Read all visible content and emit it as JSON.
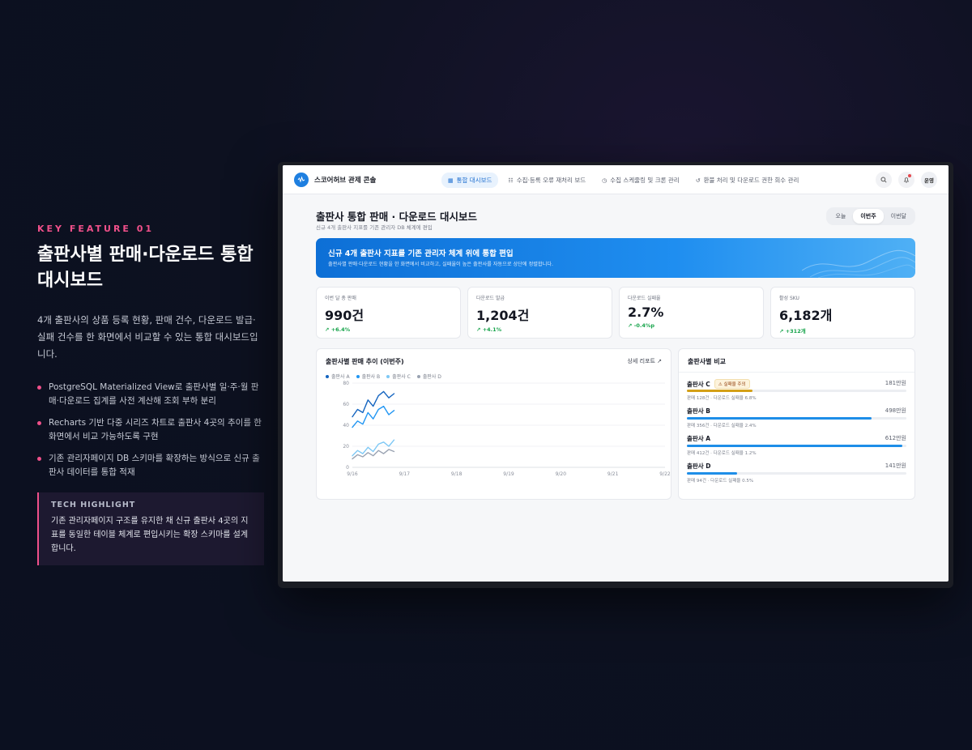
{
  "left": {
    "kicker": "KEY FEATURE 01",
    "headline": "출판사별 판매·다운로드 통합 대시보드",
    "lead": "4개 출판사의 상품 등록 현황, 판매 건수, 다운로드 발급·실패 건수를 한 화면에서 비교할 수 있는 통합 대시보드입니다.",
    "bullets": [
      "PostgreSQL Materialized View로 출판사별 일·주·월 판매·다운로드 집계를 사전 계산해 조회 부하 분리",
      "Recharts 기반 다중 시리즈 차트로 출판사 4곳의 추이를 한 화면에서 비교 가능하도록 구현",
      "기존 관리자페이지 DB 스키마를 확장하는 방식으로 신규 출판사 데이터를 통합 적재"
    ],
    "tech_title": "TECH HIGHLIGHT",
    "tech_body": "기존 관리자페이지 구조를 유지한 채 신규 출판사 4곳의 지표를 동일한 테이블 체계로 편입시키는 확장 스키마를 설계합니다."
  },
  "app": {
    "brand": "스코어허브 관제 콘솔",
    "nav": [
      {
        "label": "통합 대시보드",
        "icon": "grid-icon",
        "glyph": "▦"
      },
      {
        "label": "수집·등록 오류 재처리 보드",
        "icon": "list-icon",
        "glyph": "☷"
      },
      {
        "label": "수집 스케줄링 및 크론 관리",
        "icon": "clock-icon",
        "glyph": "◷"
      },
      {
        "label": "환불 처리 및 다운로드 권한 회수 관리",
        "icon": "undo-icon",
        "glyph": "↺"
      }
    ],
    "avatar": "운영",
    "page_title": "출판사 통합 판매 · 다운로드 대시보드",
    "page_sub": "신규 4개 출판사 지표를 기존 관리자 DB 체계에 편입",
    "periods": [
      "오늘",
      "이번주",
      "이번달"
    ],
    "banner_title": "신규 4개 출판사 지표를 기존 관리자 체계 위에 통합 편입",
    "banner_sub": "출판사별 판매·다운로드 현황을 한 화면에서 비교하고, 실패율이 높은 출판사를 자동으로 상단에 정렬합니다.",
    "kpis": [
      {
        "label": "이번 달 총 판매",
        "value": "990건",
        "delta": "↗ +6.4%"
      },
      {
        "label": "다운로드 발급",
        "value": "1,204건",
        "delta": "↗ +4.1%"
      },
      {
        "label": "다운로드 실패율",
        "value": "2.7%",
        "delta": "↗ -0.4%p"
      },
      {
        "label": "활성 SKU",
        "value": "6,182개",
        "delta": "↗ +312개"
      }
    ],
    "chart_title": "출판사별 판매 추이 (이번주)",
    "chart_link": "상세 리포트 ↗",
    "compare_title": "출판사별 비교",
    "compare": [
      {
        "name": "출판사 C",
        "badge": "⚠ 실패율 주의",
        "amount": "181만원",
        "meta": "판매 128건 · 다운로드 실패율 6.8%",
        "ratio": 0.3,
        "color": "#d4a017"
      },
      {
        "name": "출판사 B",
        "badge": "",
        "amount": "498만원",
        "meta": "판매 356건 · 다운로드 실패율 2.4%",
        "ratio": 0.84,
        "color": "#1e8ee8"
      },
      {
        "name": "출판사 A",
        "badge": "",
        "amount": "612만원",
        "meta": "판매 412건 · 다운로드 실패율 1.2%",
        "ratio": 0.98,
        "color": "#1e8ee8"
      },
      {
        "name": "출판사 D",
        "badge": "",
        "amount": "141만원",
        "meta": "판매 94건 · 다운로드 실패율 0.5%",
        "ratio": 0.23,
        "color": "#1e8ee8"
      }
    ]
  },
  "colors": {
    "accent": "#1e7fe0",
    "pink": "#f0508a",
    "warn": "#d4a017"
  },
  "chart_data": {
    "type": "line",
    "x": [
      "9/16",
      "9/17",
      "9/18",
      "9/19",
      "9/20",
      "9/21",
      "9/22"
    ],
    "ylim": [
      0,
      80
    ],
    "yticks": [
      0,
      20,
      40,
      60,
      80
    ],
    "grid": true,
    "legend": "top-left",
    "series": [
      {
        "name": "출판사 A",
        "color": "#1565c0",
        "points": [
          [
            0.0,
            48
          ],
          [
            0.1,
            55
          ],
          [
            0.2,
            52
          ],
          [
            0.3,
            64
          ],
          [
            0.4,
            58
          ],
          [
            0.5,
            68
          ],
          [
            0.6,
            72
          ],
          [
            0.7,
            66
          ],
          [
            0.8,
            70
          ]
        ]
      },
      {
        "name": "출판사 B",
        "color": "#2196f3",
        "points": [
          [
            0.0,
            38
          ],
          [
            0.1,
            44
          ],
          [
            0.2,
            41
          ],
          [
            0.3,
            52
          ],
          [
            0.4,
            46
          ],
          [
            0.5,
            55
          ],
          [
            0.6,
            58
          ],
          [
            0.7,
            50
          ],
          [
            0.8,
            54
          ]
        ]
      },
      {
        "name": "출판사 C",
        "color": "#7ec8f5",
        "points": [
          [
            0.0,
            11
          ],
          [
            0.1,
            16
          ],
          [
            0.2,
            13
          ],
          [
            0.3,
            19
          ],
          [
            0.4,
            15
          ],
          [
            0.5,
            22
          ],
          [
            0.6,
            24
          ],
          [
            0.7,
            20
          ],
          [
            0.8,
            26
          ]
        ]
      },
      {
        "name": "출판사 D",
        "color": "#9aa3b2",
        "points": [
          [
            0.0,
            8
          ],
          [
            0.1,
            12
          ],
          [
            0.2,
            10
          ],
          [
            0.3,
            14
          ],
          [
            0.4,
            11
          ],
          [
            0.5,
            16
          ],
          [
            0.6,
            13
          ],
          [
            0.7,
            17
          ],
          [
            0.8,
            15
          ]
        ]
      }
    ]
  }
}
